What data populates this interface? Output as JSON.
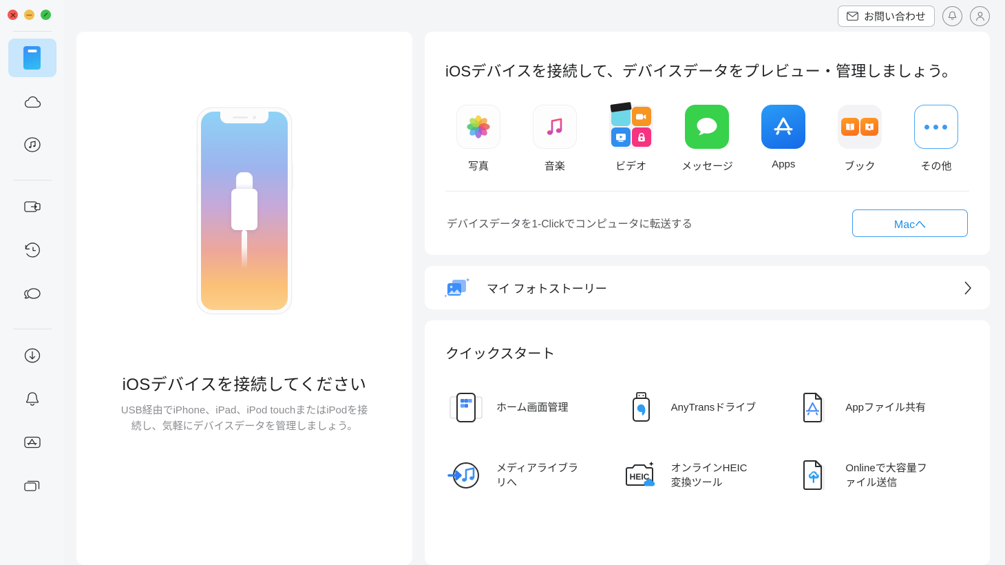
{
  "window": {
    "traffic_lights": [
      {
        "name": "close",
        "color": "#ef5b53"
      },
      {
        "name": "minimize",
        "color": "#f4bd4f"
      },
      {
        "name": "maximize",
        "color": "#3ec14e"
      }
    ]
  },
  "sidebar": {
    "groups": [
      {
        "items": [
          {
            "id": "device",
            "icon": "device-icon",
            "active": true
          },
          {
            "id": "cloud",
            "icon": "cloud-icon",
            "active": false
          },
          {
            "id": "media",
            "icon": "music-circle-icon",
            "active": false
          }
        ]
      },
      {
        "items": [
          {
            "id": "transfer",
            "icon": "phone-transfer-icon",
            "active": false
          },
          {
            "id": "backup-restore",
            "icon": "history-clock-icon",
            "active": false
          },
          {
            "id": "messages",
            "icon": "chat-bubbles-icon",
            "active": false
          }
        ]
      },
      {
        "items": [
          {
            "id": "downloader",
            "icon": "download-circle-icon",
            "active": false
          },
          {
            "id": "ringtone",
            "icon": "bell-icon",
            "active": false
          },
          {
            "id": "app-manager",
            "icon": "appstore-outline-icon",
            "active": false
          },
          {
            "id": "windows",
            "icon": "stacked-windows-icon",
            "active": false
          }
        ]
      }
    ]
  },
  "topbar": {
    "contact_label": "お問い合わせ",
    "contact_icon": "envelope-icon",
    "notification_icon": "bell-icon",
    "account_icon": "user-icon"
  },
  "left_panel": {
    "illustration": "iphone-lightning-connect-illustration",
    "title": "iOSデバイスを接続してください",
    "subtitle": "USB経由でiPhone、iPad、iPod touchまたはiPodを接続し、気軽にデバイスデータを管理しましょう。"
  },
  "device_panel": {
    "title": "iOSデバイスを接続して、デバイスデータをプレビュー・管理しましょう。",
    "categories": [
      {
        "label": "写真",
        "icon": "photos-icon"
      },
      {
        "label": "音楽",
        "icon": "music-icon"
      },
      {
        "label": "ビデオ",
        "icon": "video-icon"
      },
      {
        "label": "メッセージ",
        "icon": "messages-icon"
      },
      {
        "label": "Apps",
        "icon": "appstore-icon"
      },
      {
        "label": "ブック",
        "icon": "books-icon"
      },
      {
        "label": "その他",
        "icon": "more-dots-icon"
      }
    ],
    "transfer_text": "デバイスデータを1-Clickでコンピュータに転送する",
    "transfer_button": "Macへ"
  },
  "photo_story": {
    "label": "マイ フォトストーリー",
    "icon": "photo-stack-sparkle-icon",
    "chevron": "chevron-right-icon"
  },
  "quick_start": {
    "title": "クイックスタート",
    "items": [
      {
        "label": "ホーム画面管理",
        "icon": "home-screen-manager-icon"
      },
      {
        "label": "AnyTransドライブ",
        "icon": "usb-drive-icon"
      },
      {
        "label": "Appファイル共有",
        "icon": "app-file-sharing-icon"
      },
      {
        "label": "メディアライブラリへ",
        "icon": "media-library-icon"
      },
      {
        "label": "オンラインHEIC変換ツール",
        "icon": "heic-converter-icon"
      },
      {
        "label": "Onlineで大容量ファイル送信",
        "icon": "cloud-upload-file-icon"
      }
    ]
  },
  "colors": {
    "accent_blue": "#3c9bef",
    "page_bg": "#f4f5f7",
    "sidebar_bg": "#f6f7f8",
    "sidebar_active": "#c8e6fc",
    "card_bg": "#ffffff"
  }
}
